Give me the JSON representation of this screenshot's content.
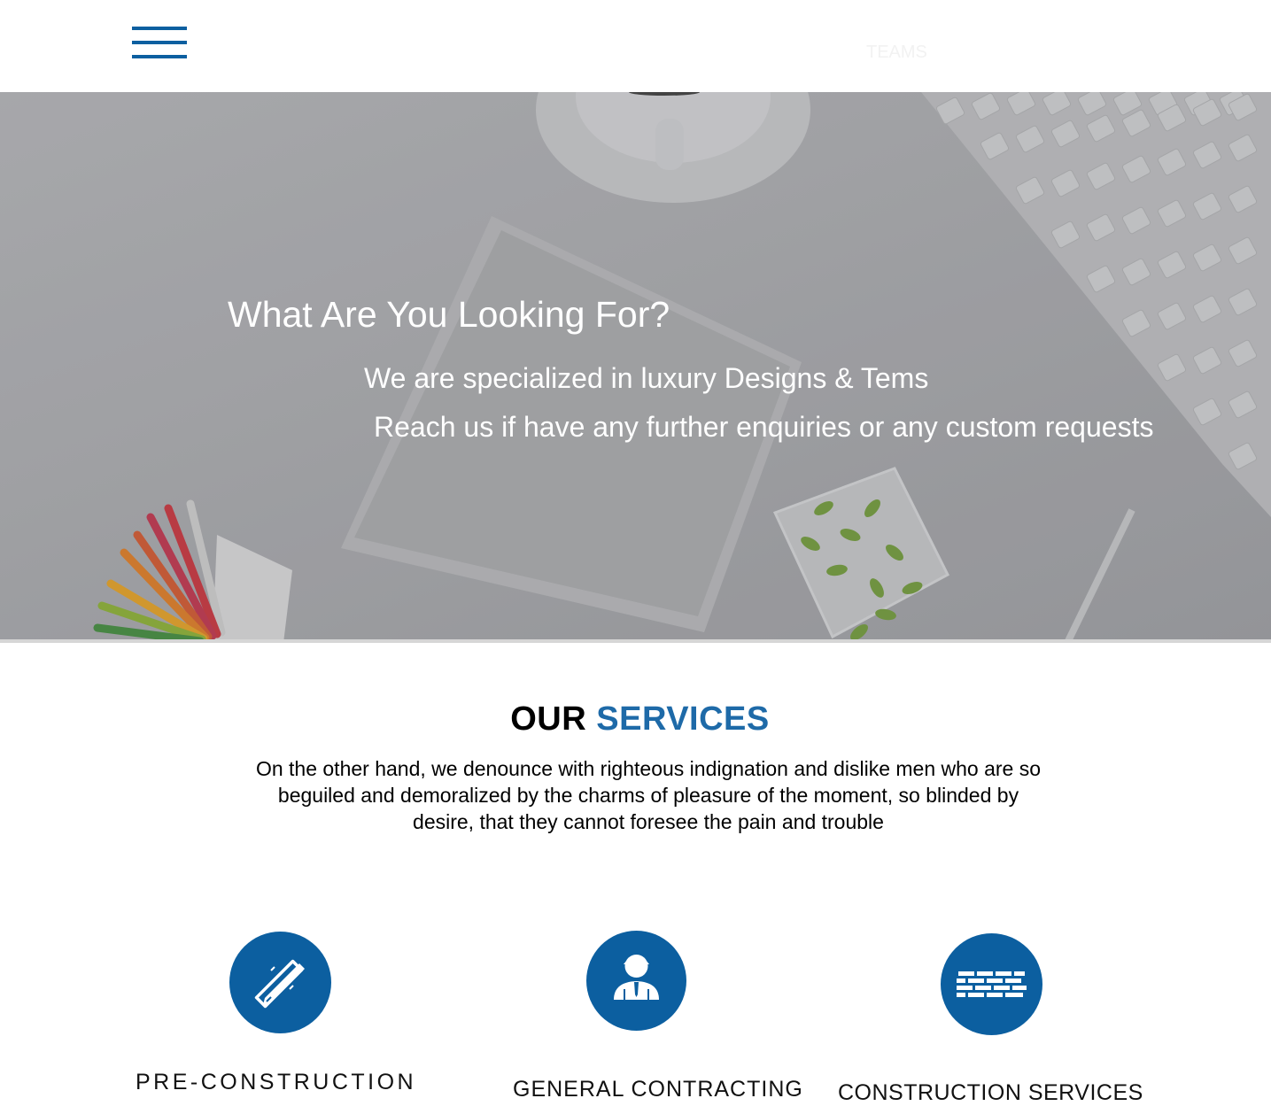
{
  "header": {
    "nav_link": "TEAMS"
  },
  "hero": {
    "title": "What Are You Looking For?",
    "line1": "We are specialized in luxury Designs & Tems",
    "line2": "Reach us if have any further enquiries or any custom requests"
  },
  "services": {
    "title_part1": "OUR",
    "title_part2": "SERVICES",
    "description": "On the other hand, we denounce with righteous indignation and dislike men who are so beguiled and demoralized by the charms of pleasure of the moment, so blinded by desire, that they cannot foresee the pain and trouble",
    "items": [
      {
        "label": "PRE-CONSTRUCTION",
        "icon": "pencil-ruler-icon"
      },
      {
        "label": "GENERAL CONTRACTING",
        "icon": "contractor-person-icon"
      },
      {
        "label": "CONSTRUCTION SERVICES",
        "icon": "brick-wall-icon"
      }
    ]
  },
  "colors": {
    "accent": "#1e6aa8",
    "icon_circle": "#0c5fa0",
    "hamburger": "#0c5fa0"
  }
}
